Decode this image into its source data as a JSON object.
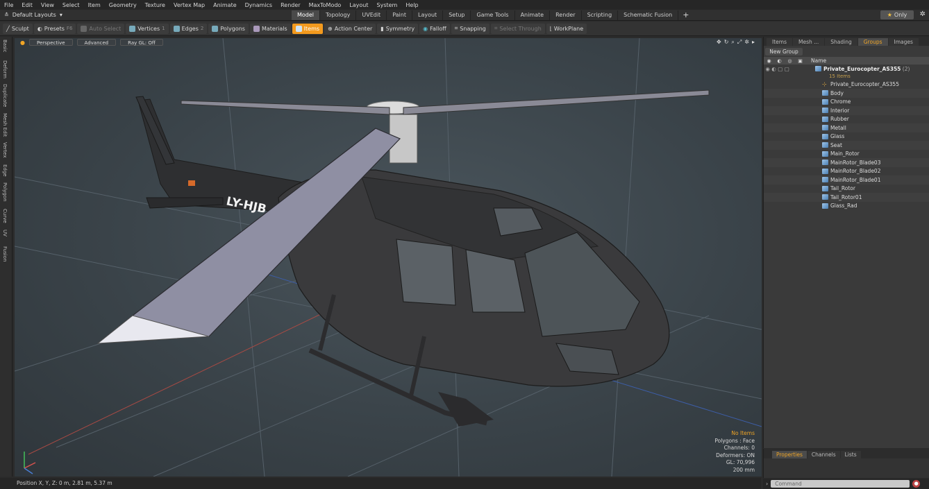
{
  "menubar": [
    "File",
    "Edit",
    "View",
    "Select",
    "Item",
    "Geometry",
    "Texture",
    "Vertex Map",
    "Animate",
    "Dynamics",
    "Render",
    "MaxToModo",
    "Layout",
    "System",
    "Help"
  ],
  "layout": {
    "label": "Default Layouts"
  },
  "modes": [
    "Model",
    "Topology",
    "UVEdit",
    "Paint",
    "Layout",
    "Setup",
    "Game Tools",
    "Animate",
    "Render",
    "Scripting",
    "Schematic Fusion"
  ],
  "active_mode": "Model",
  "only_label": "Only",
  "toolbar": {
    "sculpt": "Sculpt",
    "presets": "Presets",
    "presets_key": "F6",
    "auto_select": "Auto Select",
    "vertices": "Vertices",
    "vertices_key": "1",
    "edges": "Edges",
    "edges_key": "2",
    "polygons": "Polygons",
    "materials": "Materials",
    "items": "Items",
    "action_center": "Action Center",
    "symmetry": "Symmetry",
    "falloff": "Falloff",
    "snapping": "Snapping",
    "select_through": "Select Through",
    "workplane": "WorkPlane"
  },
  "left_tabs": [
    "Basic",
    "Deform",
    "Duplicate",
    "Mesh Edit",
    "Vertex",
    "Edge",
    "Polygon",
    "Curve",
    "UV",
    "Fusion"
  ],
  "viewport": {
    "view": "Perspective",
    "shading": "Advanced",
    "raygl": "Ray GL: Off",
    "tail_number": "LY-HJB",
    "info": [
      "No Items",
      "Polygons : Face",
      "Channels: 0",
      "Deformers: ON",
      "GL: 70,996",
      "200 mm"
    ]
  },
  "status": "Position X, Y, Z:  0 m, 2.81 m, 5.37 m",
  "right_tabs": [
    "Items",
    "Mesh ...",
    "Shading",
    "Groups",
    "Images"
  ],
  "active_right_tab": "Groups",
  "groups": {
    "new_group": "New Group",
    "name_col": "Name",
    "root": "Private_Eurocopter_AS355",
    "root_count": "(2)",
    "items_count": "15 Items",
    "children": [
      "Private_Eurocopter_AS355",
      "Body",
      "Chrome",
      "Interior",
      "Rubber",
      "Metall",
      "Glass",
      "Seat",
      "Main_Rotor",
      "MainRotor_Blade03",
      "MainRotor_Blade02",
      "MainRotor_Blade01",
      "Tail_Rotor",
      "Tail_Rotor01",
      "Glass_Rad"
    ]
  },
  "bottom_tabs": [
    "Properties",
    "Channels",
    "Lists"
  ],
  "command_placeholder": "Command",
  "colors": {
    "accent": "#f39a1e",
    "body": "#3a3a3c",
    "blade": "#8f8fa3"
  }
}
